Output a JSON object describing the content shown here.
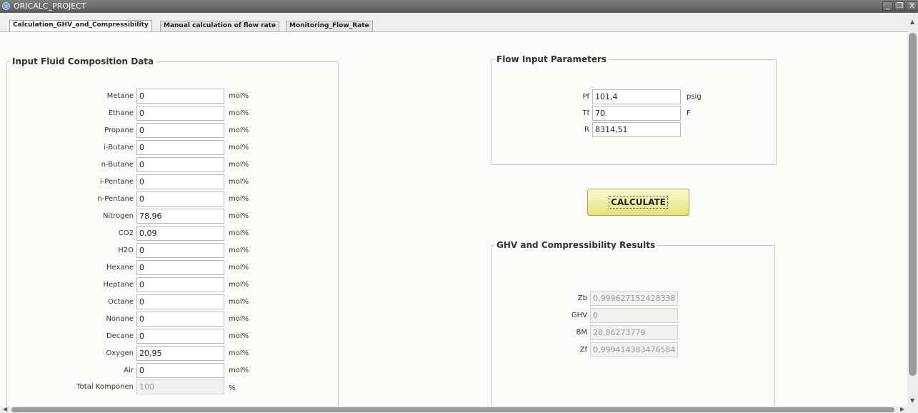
{
  "window": {
    "title": "ORICALC_PROJECT",
    "minimize": "_",
    "restore": "❐",
    "close": "X"
  },
  "tabs": [
    {
      "label": "Calculation_GHV_and_Compressibility"
    },
    {
      "label": "Manual calculation of flow rate"
    },
    {
      "label": "Monitoring_Flow_Rate"
    }
  ],
  "composition": {
    "legend": "Input Fluid Composition Data",
    "unit": "mol%",
    "rows": [
      {
        "label": "Metane",
        "value": "0"
      },
      {
        "label": "Ethane",
        "value": "0"
      },
      {
        "label": "Propane",
        "value": "0"
      },
      {
        "label": "i-Butane",
        "value": "0"
      },
      {
        "label": "n-Butane",
        "value": "0"
      },
      {
        "label": "i-Pentane",
        "value": "0"
      },
      {
        "label": "n-Pentane",
        "value": "0"
      },
      {
        "label": "Nitrogen",
        "value": "78,96"
      },
      {
        "label": "CO2",
        "value": "0,09"
      },
      {
        "label": "H2O",
        "value": "0"
      },
      {
        "label": "Hexane",
        "value": "0"
      },
      {
        "label": "Heptane",
        "value": "0"
      },
      {
        "label": "Octane",
        "value": "0"
      },
      {
        "label": "Nonane",
        "value": "0"
      },
      {
        "label": "Decane",
        "value": "0"
      },
      {
        "label": "Oxygen",
        "value": "20,95"
      },
      {
        "label": "Air",
        "value": "0"
      }
    ],
    "total": {
      "label": "Total Komponen",
      "value": "100",
      "unit": "%"
    }
  },
  "flow": {
    "legend": "Flow Input Parameters",
    "rows": [
      {
        "label": "Pf",
        "value": "101,4",
        "unit": "psig"
      },
      {
        "label": "Tf",
        "value": "70",
        "unit": "F"
      },
      {
        "label": "R",
        "value": "8314,51",
        "unit": ""
      }
    ]
  },
  "calculate_label": "CALCULATE",
  "results": {
    "legend": "GHV and Compressibility Results",
    "rows": [
      {
        "label": "Zb",
        "value": "0,999627152428338"
      },
      {
        "label": "GHV",
        "value": "0"
      },
      {
        "label": "BM",
        "value": "28,86273779"
      },
      {
        "label": "Zf",
        "value": "0,999414383476584"
      }
    ]
  },
  "colors": {
    "button": "#e6e27a",
    "titlebar": "#6b6b6b"
  }
}
